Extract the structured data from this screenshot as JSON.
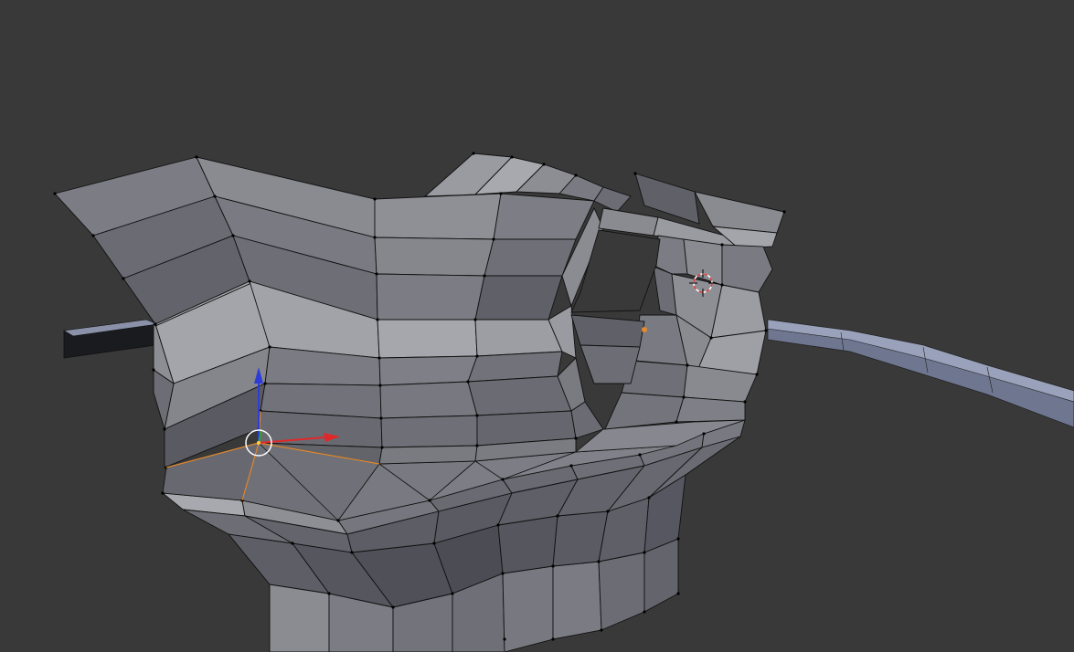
{
  "app": {
    "view": "3d-viewport",
    "mode": "edit-mode",
    "background_color": "#393939"
  },
  "scene": {
    "mesh_face_color": "#6f7077",
    "mesh_edge_color": "#111111",
    "vertex_color": "#000000",
    "ground_strip_color": "#6e7690",
    "selected_edge_color": "#e38a2e"
  },
  "gizmo": {
    "x_axis_color": "#e0282a",
    "y_axis_color": "#2fa52f",
    "z_axis_color": "#2f3bd8",
    "center_color": "#ffffff"
  },
  "cursor": {
    "outer_color": "#d93a3a",
    "inner_color": "#ffffff"
  },
  "icons": {
    "transform_manipulator": "transform-gizmo-icon",
    "three_d_cursor": "3d-cursor-icon"
  }
}
